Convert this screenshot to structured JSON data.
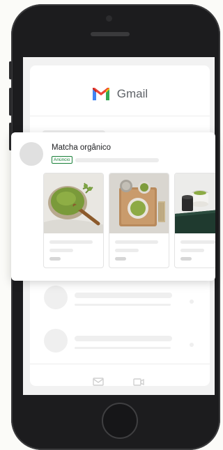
{
  "app": {
    "title": "Gmail",
    "icon": "gmail-logo-icon"
  },
  "ad": {
    "title": "Matcha orgânico",
    "badge": "Anúncio",
    "products": [
      {
        "image": "matcha-powder-bowl-image"
      },
      {
        "image": "matcha-tea-tray-image"
      },
      {
        "image": "matcha-cup-tin-image"
      }
    ]
  },
  "bottom_bar": {
    "icons": [
      "mail-icon",
      "video-icon"
    ]
  },
  "colors": {
    "gmail_red": "#ea4335",
    "gmail_blue": "#4285f4",
    "gmail_green": "#34a853",
    "gmail_yellow": "#fbbc04",
    "ad_badge": "#188038",
    "phone_body": "#1c1c1e"
  }
}
